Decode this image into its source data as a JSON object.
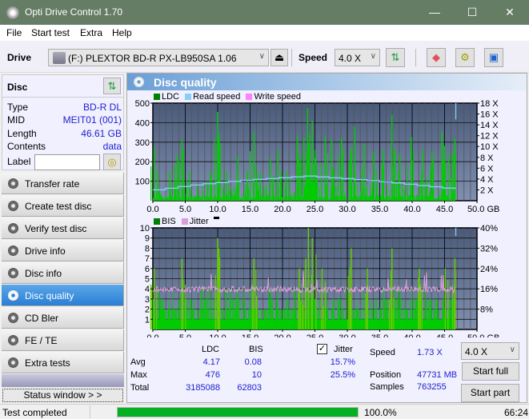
{
  "window": {
    "title": "Opti Drive Control 1.70",
    "minimize": "—",
    "maximize": "☐",
    "close": "✕"
  },
  "menu": {
    "items": [
      {
        "label": "File",
        "accel": "F"
      },
      {
        "label": "Start test",
        "accel": "S"
      },
      {
        "label": "Extra",
        "accel": "x"
      },
      {
        "label": "Help",
        "accel": "H"
      }
    ]
  },
  "toolbar": {
    "drive_label": "Drive",
    "drive_value": "(F:)  PLEXTOR BD-R  PX-LB950SA 1.06",
    "speed_label": "Speed",
    "speed_value": "4.0 X",
    "icons": [
      "eject-icon",
      "refresh-icon",
      "erase-icon",
      "settings-icon",
      "save-icon"
    ]
  },
  "disc": {
    "header": "Disc",
    "rows": [
      {
        "key": "Type",
        "value": "BD-R DL"
      },
      {
        "key": "MID",
        "value": "MEIT01 (001)"
      },
      {
        "key": "Length",
        "value": "46.61 GB"
      },
      {
        "key": "Contents",
        "value": "data"
      }
    ],
    "label_key": "Label",
    "label_value": ""
  },
  "nav": {
    "items": [
      {
        "label": "Transfer rate",
        "active": false
      },
      {
        "label": "Create test disc",
        "active": false
      },
      {
        "label": "Verify test disc",
        "active": false
      },
      {
        "label": "Drive info",
        "active": false
      },
      {
        "label": "Disc info",
        "active": false
      },
      {
        "label": "Disc quality",
        "active": true
      },
      {
        "label": "CD Bler",
        "active": false
      },
      {
        "label": "FE / TE",
        "active": false
      },
      {
        "label": "Extra tests",
        "active": false
      }
    ],
    "status_window": "Status window > >"
  },
  "panel": {
    "title": "Disc quality"
  },
  "colors": {
    "ldc": "#008000",
    "read_speed": "#87cefa",
    "write_speed": "#ff80ff",
    "bis": "#008000",
    "jitter": "#d8a0d8",
    "bar_green": "#00cc00",
    "plot_bg_top": "#4a5a7a",
    "plot_bg_bottom": "#8090b0"
  },
  "chart_data": [
    {
      "type": "bar",
      "title": "LDC / Read speed",
      "legend": [
        "LDC",
        "Read speed",
        "Write speed"
      ],
      "xlabel": "GB",
      "xlim": [
        0,
        50
      ],
      "x_ticks": [
        "0.0",
        "5.0",
        "10.0",
        "15.0",
        "20.0",
        "25.0",
        "30.0",
        "35.0",
        "40.0",
        "45.0",
        "50.0 GB"
      ],
      "ylim_left": [
        0,
        500
      ],
      "y_ticks_left": [
        "500",
        "400",
        "300",
        "200",
        "100"
      ],
      "ylim_right": [
        0,
        18
      ],
      "y_ticks_right": [
        "18 X",
        "16 X",
        "14 X",
        "12 X",
        "10 X",
        "8 X",
        "6 X",
        "4 X",
        "2 X"
      ],
      "data_end_gb": 46.61,
      "ldc_peaks": [
        {
          "x": 0.1,
          "y": 275
        },
        {
          "x": 1.0,
          "y": 40
        },
        {
          "x": 2.5,
          "y": 150
        },
        {
          "x": 3.7,
          "y": 235
        },
        {
          "x": 4.4,
          "y": 310
        },
        {
          "x": 5.6,
          "y": 150
        },
        {
          "x": 8.8,
          "y": 150
        },
        {
          "x": 9.9,
          "y": 455
        },
        {
          "x": 10.1,
          "y": 340
        },
        {
          "x": 11.2,
          "y": 150
        },
        {
          "x": 13.0,
          "y": 225
        },
        {
          "x": 14.5,
          "y": 150
        },
        {
          "x": 15.5,
          "y": 355
        },
        {
          "x": 16.5,
          "y": 150
        },
        {
          "x": 18.0,
          "y": 215
        },
        {
          "x": 19.2,
          "y": 260
        },
        {
          "x": 20.5,
          "y": 150
        },
        {
          "x": 22.2,
          "y": 335
        },
        {
          "x": 23.2,
          "y": 320
        },
        {
          "x": 23.8,
          "y": 475
        },
        {
          "x": 24.5,
          "y": 410
        },
        {
          "x": 25.0,
          "y": 260
        },
        {
          "x": 26.5,
          "y": 330
        },
        {
          "x": 27.5,
          "y": 310
        },
        {
          "x": 29.0,
          "y": 320
        },
        {
          "x": 30.5,
          "y": 270
        },
        {
          "x": 31.0,
          "y": 380
        },
        {
          "x": 32.5,
          "y": 290
        },
        {
          "x": 34.0,
          "y": 250
        },
        {
          "x": 35.5,
          "y": 260
        },
        {
          "x": 36.8,
          "y": 440
        },
        {
          "x": 38.0,
          "y": 240
        },
        {
          "x": 39.8,
          "y": 325
        },
        {
          "x": 41.5,
          "y": 260
        },
        {
          "x": 43.0,
          "y": 250
        },
        {
          "x": 44.5,
          "y": 355
        },
        {
          "x": 45.5,
          "y": 230
        },
        {
          "x": 46.5,
          "y": 320
        }
      ],
      "read_speed": [
        {
          "x": 0,
          "y": 2.0
        },
        {
          "x": 5,
          "y": 2.8
        },
        {
          "x": 10,
          "y": 3.4
        },
        {
          "x": 15,
          "y": 3.9
        },
        {
          "x": 20,
          "y": 4.3
        },
        {
          "x": 24,
          "y": 4.6
        },
        {
          "x": 25,
          "y": 4.4
        },
        {
          "x": 30,
          "y": 4.0
        },
        {
          "x": 35,
          "y": 3.5
        },
        {
          "x": 40,
          "y": 2.9
        },
        {
          "x": 46.6,
          "y": 2.1
        }
      ]
    },
    {
      "type": "bar",
      "title": "BIS / Jitter",
      "legend": [
        "BIS",
        "Jitter"
      ],
      "xlabel": "GB",
      "xlim": [
        0,
        50
      ],
      "x_ticks": [
        "0.0",
        "5.0",
        "10.0",
        "15.0",
        "20.0",
        "25.0",
        "30.0",
        "35.0",
        "40.0",
        "45.0",
        "50.0 GB"
      ],
      "ylim_left": [
        0,
        10
      ],
      "y_ticks_left": [
        "10",
        "9",
        "8",
        "7",
        "6",
        "5",
        "4",
        "3",
        "2",
        "1"
      ],
      "ylim_right": [
        0,
        40
      ],
      "y_ticks_right": [
        "40%",
        "32%",
        "24%",
        "16%",
        "8%"
      ],
      "data_end_gb": 46.61,
      "bis_peaks": [
        {
          "x": 0.1,
          "y": 6
        },
        {
          "x": 4.4,
          "y": 7
        },
        {
          "x": 9.9,
          "y": 9
        },
        {
          "x": 10.1,
          "y": 8
        },
        {
          "x": 15.5,
          "y": 7
        },
        {
          "x": 22.5,
          "y": 6
        },
        {
          "x": 23.5,
          "y": 7
        },
        {
          "x": 23.9,
          "y": 10
        },
        {
          "x": 24.5,
          "y": 9
        },
        {
          "x": 26.0,
          "y": 6
        },
        {
          "x": 30.5,
          "y": 8
        },
        {
          "x": 33.0,
          "y": 6
        },
        {
          "x": 36.8,
          "y": 8
        },
        {
          "x": 41.0,
          "y": 6
        },
        {
          "x": 45.0,
          "y": 6
        },
        {
          "x": 46.5,
          "y": 7
        }
      ],
      "jitter_avg_pct": 15.7,
      "jitter_max_pct": 25.5
    }
  ],
  "stats": {
    "col_ldc": "LDC",
    "col_bis": "BIS",
    "jitter_label": "Jitter",
    "jitter_checked": true,
    "rows": [
      {
        "label": "Avg",
        "ldc": "4.17",
        "bis": "0.08",
        "jitter": "15.7%"
      },
      {
        "label": "Max",
        "ldc": "476",
        "bis": "10",
        "jitter": "25.5%"
      },
      {
        "label": "Total",
        "ldc": "3185088",
        "bis": "62803",
        "jitter": ""
      }
    ],
    "speed_label": "Speed",
    "speed_value": "1.73 X",
    "position_label": "Position",
    "position_value": "47731 MB",
    "samples_label": "Samples",
    "samples_value": "763255",
    "speed_select": "4.0 X",
    "start_full": "Start full",
    "start_part": "Start part"
  },
  "statusbar": {
    "text": "Test completed",
    "progress_pct": 100.0,
    "progress_text": "100.0%",
    "time": "66:24"
  }
}
